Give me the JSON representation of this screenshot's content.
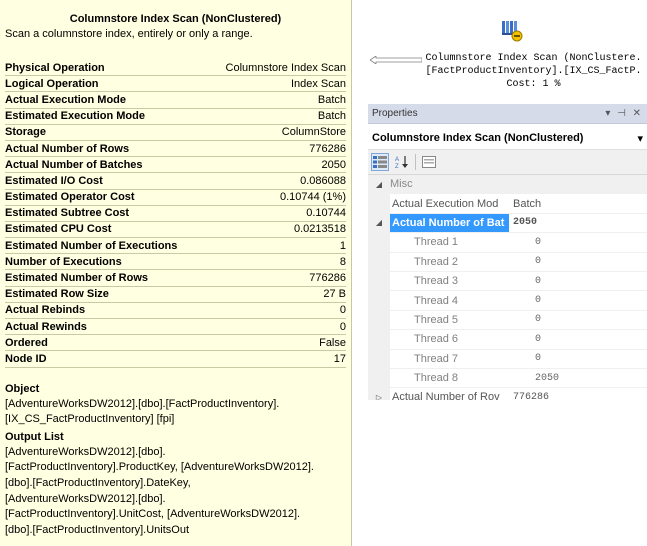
{
  "tooltip": {
    "title": "Columnstore Index Scan (NonClustered)",
    "description": "Scan a columnstore index, entirely or only a range.",
    "rows": [
      {
        "label": "Physical Operation",
        "value": "Columnstore Index Scan",
        "bold_value": false
      },
      {
        "label": "Logical Operation",
        "value": "Index Scan"
      },
      {
        "label": "Actual Execution Mode",
        "value": "Batch"
      },
      {
        "label": "Estimated Execution Mode",
        "value": "Batch"
      },
      {
        "label": "Storage",
        "value": "ColumnStore"
      },
      {
        "label": "Actual Number of Rows",
        "value": "776286"
      },
      {
        "label": "Actual Number of Batches",
        "value": "2050"
      },
      {
        "label": "Estimated I/O Cost",
        "value": "0.086088"
      },
      {
        "label": "Estimated Operator Cost",
        "value": "0.10744 (1%)"
      },
      {
        "label": "Estimated Subtree Cost",
        "value": "0.10744"
      },
      {
        "label": "Estimated CPU Cost",
        "value": "0.0213518"
      },
      {
        "label": "Estimated Number of Executions",
        "value": "1"
      },
      {
        "label": "Number of Executions",
        "value": "8"
      },
      {
        "label": "Estimated Number of Rows",
        "value": "776286"
      },
      {
        "label": "Estimated Row Size",
        "value": "27 B"
      },
      {
        "label": "Actual Rebinds",
        "value": "0"
      },
      {
        "label": "Actual Rewinds",
        "value": "0"
      },
      {
        "label": "Ordered",
        "value": "False"
      },
      {
        "label": "Node ID",
        "value": "17"
      }
    ],
    "object_title": "Object",
    "object_lines": [
      "[AdventureWorksDW2012].[dbo].[FactProductInventory].",
      "[IX_CS_FactProductInventory] [fpi]"
    ],
    "output_title": "Output List",
    "output_lines": [
      "[AdventureWorksDW2012].[dbo].",
      "[FactProductInventory].ProductKey, [AdventureWorksDW2012].",
      "[dbo].[FactProductInventory].DateKey,",
      "[AdventureWorksDW2012].[dbo].",
      "[FactProductInventory].UnitCost, [AdventureWorksDW2012].",
      "[dbo].[FactProductInventory].UnitsOut"
    ]
  },
  "plan_node": {
    "icon": "columnstore-index-scan-icon",
    "label_lines": [
      "Columnstore Index Scan (NonClustere.",
      "[FactProductInventory].[IX_CS_FactP.",
      "Cost: 1 %"
    ]
  },
  "properties": {
    "title": "Properties",
    "title_controls": "▾ ⊣ ✕",
    "selector_value": "Columnstore Index Scan (NonClustered)",
    "selector_arrow": "▾",
    "toolbar": {
      "categorized_icon": "categorized-icon",
      "alphabetical_icon": "alphabetical-icon",
      "property_pages_icon": "property-pages-icon"
    },
    "category": {
      "expander": "◢",
      "label": "Misc"
    },
    "rows": [
      {
        "name": "Actual Execution Mod",
        "value": "Batch"
      },
      {
        "name": "Actual Number of Bat",
        "value": "2050",
        "selected": true,
        "expander": "◢"
      },
      {
        "name": "Thread 1",
        "value": "0"
      },
      {
        "name": "Thread 2",
        "value": "0"
      },
      {
        "name": "Thread 3",
        "value": "0"
      },
      {
        "name": "Thread 4",
        "value": "0"
      },
      {
        "name": "Thread 5",
        "value": "0"
      },
      {
        "name": "Thread 6",
        "value": "0"
      },
      {
        "name": "Thread 7",
        "value": "0"
      },
      {
        "name": "Thread 8",
        "value": "2050"
      },
      {
        "name": "Actual Number of Rov",
        "value": "776286",
        "expander": "▷"
      }
    ]
  },
  "colors": {
    "tooltip_bg": "#ffffe1",
    "selection": "#3399ff",
    "titlebar": "#d6dbe9"
  }
}
